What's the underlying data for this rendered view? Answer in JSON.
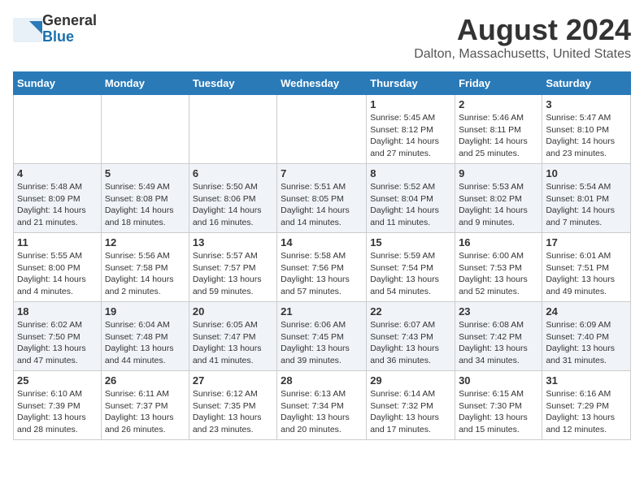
{
  "header": {
    "logo_line1": "General",
    "logo_line2": "Blue",
    "month_year": "August 2024",
    "location": "Dalton, Massachusetts, United States"
  },
  "days_of_week": [
    "Sunday",
    "Monday",
    "Tuesday",
    "Wednesday",
    "Thursday",
    "Friday",
    "Saturday"
  ],
  "weeks": [
    [
      {
        "day": "",
        "info": ""
      },
      {
        "day": "",
        "info": ""
      },
      {
        "day": "",
        "info": ""
      },
      {
        "day": "",
        "info": ""
      },
      {
        "day": "1",
        "info": "Sunrise: 5:45 AM\nSunset: 8:12 PM\nDaylight: 14 hours\nand 27 minutes."
      },
      {
        "day": "2",
        "info": "Sunrise: 5:46 AM\nSunset: 8:11 PM\nDaylight: 14 hours\nand 25 minutes."
      },
      {
        "day": "3",
        "info": "Sunrise: 5:47 AM\nSunset: 8:10 PM\nDaylight: 14 hours\nand 23 minutes."
      }
    ],
    [
      {
        "day": "4",
        "info": "Sunrise: 5:48 AM\nSunset: 8:09 PM\nDaylight: 14 hours\nand 21 minutes."
      },
      {
        "day": "5",
        "info": "Sunrise: 5:49 AM\nSunset: 8:08 PM\nDaylight: 14 hours\nand 18 minutes."
      },
      {
        "day": "6",
        "info": "Sunrise: 5:50 AM\nSunset: 8:06 PM\nDaylight: 14 hours\nand 16 minutes."
      },
      {
        "day": "7",
        "info": "Sunrise: 5:51 AM\nSunset: 8:05 PM\nDaylight: 14 hours\nand 14 minutes."
      },
      {
        "day": "8",
        "info": "Sunrise: 5:52 AM\nSunset: 8:04 PM\nDaylight: 14 hours\nand 11 minutes."
      },
      {
        "day": "9",
        "info": "Sunrise: 5:53 AM\nSunset: 8:02 PM\nDaylight: 14 hours\nand 9 minutes."
      },
      {
        "day": "10",
        "info": "Sunrise: 5:54 AM\nSunset: 8:01 PM\nDaylight: 14 hours\nand 7 minutes."
      }
    ],
    [
      {
        "day": "11",
        "info": "Sunrise: 5:55 AM\nSunset: 8:00 PM\nDaylight: 14 hours\nand 4 minutes."
      },
      {
        "day": "12",
        "info": "Sunrise: 5:56 AM\nSunset: 7:58 PM\nDaylight: 14 hours\nand 2 minutes."
      },
      {
        "day": "13",
        "info": "Sunrise: 5:57 AM\nSunset: 7:57 PM\nDaylight: 13 hours\nand 59 minutes."
      },
      {
        "day": "14",
        "info": "Sunrise: 5:58 AM\nSunset: 7:56 PM\nDaylight: 13 hours\nand 57 minutes."
      },
      {
        "day": "15",
        "info": "Sunrise: 5:59 AM\nSunset: 7:54 PM\nDaylight: 13 hours\nand 54 minutes."
      },
      {
        "day": "16",
        "info": "Sunrise: 6:00 AM\nSunset: 7:53 PM\nDaylight: 13 hours\nand 52 minutes."
      },
      {
        "day": "17",
        "info": "Sunrise: 6:01 AM\nSunset: 7:51 PM\nDaylight: 13 hours\nand 49 minutes."
      }
    ],
    [
      {
        "day": "18",
        "info": "Sunrise: 6:02 AM\nSunset: 7:50 PM\nDaylight: 13 hours\nand 47 minutes."
      },
      {
        "day": "19",
        "info": "Sunrise: 6:04 AM\nSunset: 7:48 PM\nDaylight: 13 hours\nand 44 minutes."
      },
      {
        "day": "20",
        "info": "Sunrise: 6:05 AM\nSunset: 7:47 PM\nDaylight: 13 hours\nand 41 minutes."
      },
      {
        "day": "21",
        "info": "Sunrise: 6:06 AM\nSunset: 7:45 PM\nDaylight: 13 hours\nand 39 minutes."
      },
      {
        "day": "22",
        "info": "Sunrise: 6:07 AM\nSunset: 7:43 PM\nDaylight: 13 hours\nand 36 minutes."
      },
      {
        "day": "23",
        "info": "Sunrise: 6:08 AM\nSunset: 7:42 PM\nDaylight: 13 hours\nand 34 minutes."
      },
      {
        "day": "24",
        "info": "Sunrise: 6:09 AM\nSunset: 7:40 PM\nDaylight: 13 hours\nand 31 minutes."
      }
    ],
    [
      {
        "day": "25",
        "info": "Sunrise: 6:10 AM\nSunset: 7:39 PM\nDaylight: 13 hours\nand 28 minutes."
      },
      {
        "day": "26",
        "info": "Sunrise: 6:11 AM\nSunset: 7:37 PM\nDaylight: 13 hours\nand 26 minutes."
      },
      {
        "day": "27",
        "info": "Sunrise: 6:12 AM\nSunset: 7:35 PM\nDaylight: 13 hours\nand 23 minutes."
      },
      {
        "day": "28",
        "info": "Sunrise: 6:13 AM\nSunset: 7:34 PM\nDaylight: 13 hours\nand 20 minutes."
      },
      {
        "day": "29",
        "info": "Sunrise: 6:14 AM\nSunset: 7:32 PM\nDaylight: 13 hours\nand 17 minutes."
      },
      {
        "day": "30",
        "info": "Sunrise: 6:15 AM\nSunset: 7:30 PM\nDaylight: 13 hours\nand 15 minutes."
      },
      {
        "day": "31",
        "info": "Sunrise: 6:16 AM\nSunset: 7:29 PM\nDaylight: 13 hours\nand 12 minutes."
      }
    ]
  ]
}
